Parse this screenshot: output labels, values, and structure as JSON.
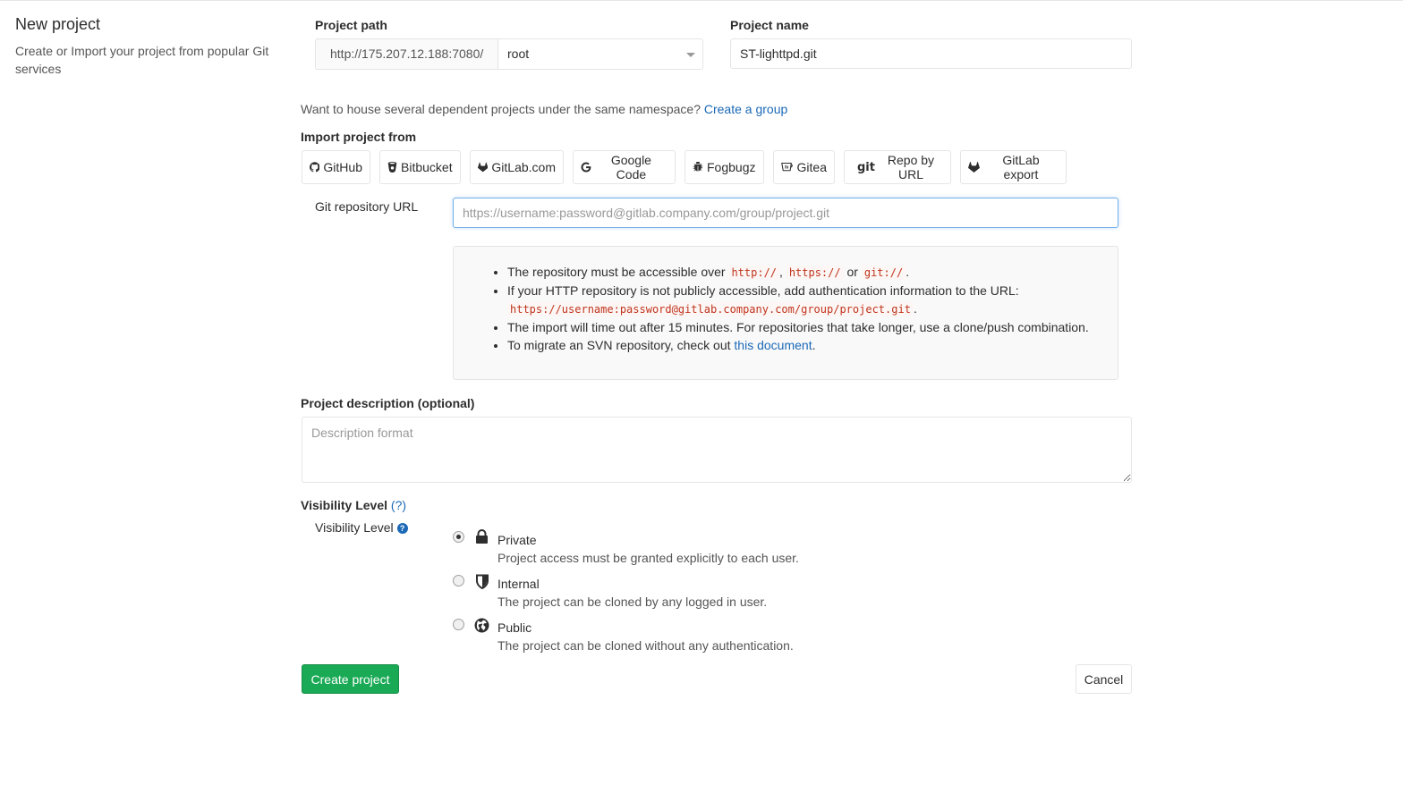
{
  "page": {
    "title": "New project",
    "description": "Create or Import your project from popular Git services"
  },
  "project_path": {
    "label": "Project path",
    "base_url": "http://175.207.12.188:7080/",
    "namespace": "root"
  },
  "project_name": {
    "label": "Project name",
    "value": "ST-lighttpd.git"
  },
  "namespace_hint": {
    "text": "Want to house several dependent projects under the same namespace?",
    "link": "Create a group"
  },
  "import": {
    "label": "Import project from",
    "sources": [
      {
        "label": "GitHub",
        "icon": "github-icon"
      },
      {
        "label": "Bitbucket",
        "icon": "bitbucket-icon"
      },
      {
        "label": "GitLab.com",
        "icon": "gitlab-icon"
      },
      {
        "label": "Google Code",
        "icon": "google-icon"
      },
      {
        "label": "Fogbugz",
        "icon": "bug-icon"
      },
      {
        "label": "Gitea",
        "icon": "gitea-icon"
      },
      {
        "label": "Repo by URL",
        "icon": "git-icon"
      },
      {
        "label": "GitLab export",
        "icon": "gitlab-icon"
      }
    ],
    "git_url_label": "Git repository URL",
    "git_url_placeholder": "https://username:password@gitlab.company.com/group/project.git",
    "git_url_value": ""
  },
  "help": {
    "line1_prefix": "The repository must be accessible over",
    "proto_http": "http://",
    "sep_comma": ",",
    "proto_https": "https://",
    "or_word": "or",
    "proto_git": "git://",
    "period": ".",
    "line2": "If your HTTP repository is not publicly accessible, add authentication information to the URL:",
    "auth_example": "https://username:password@gitlab.company.com/group/project.git",
    "line3": "The import will time out after 15 minutes. For repositories that take longer, use a clone/push combination.",
    "line4_prefix": "To migrate an SVN repository, check out",
    "line4_link": "this document",
    "line4_suffix": "."
  },
  "description": {
    "label": "Project description (optional)",
    "placeholder": "Description format",
    "value": ""
  },
  "visibility": {
    "heading": "Visibility Level",
    "help_link": "(?)",
    "sub_label": "Visibility Level",
    "help_icon_glyph": "?",
    "selected": "Private",
    "options": [
      {
        "title": "Private",
        "description": "Project access must be granted explicitly to each user.",
        "icon": "lock-icon"
      },
      {
        "title": "Internal",
        "description": "The project can be cloned by any logged in user.",
        "icon": "shield-icon"
      },
      {
        "title": "Public",
        "description": "The project can be cloned without any authentication.",
        "icon": "globe-icon"
      }
    ]
  },
  "actions": {
    "create": "Create project",
    "cancel": "Cancel"
  },
  "colors": {
    "primary_green": "#1aaa55",
    "link_blue": "#1b69b6",
    "code_red": "#c0341d",
    "focus_blue": "#73afea"
  }
}
